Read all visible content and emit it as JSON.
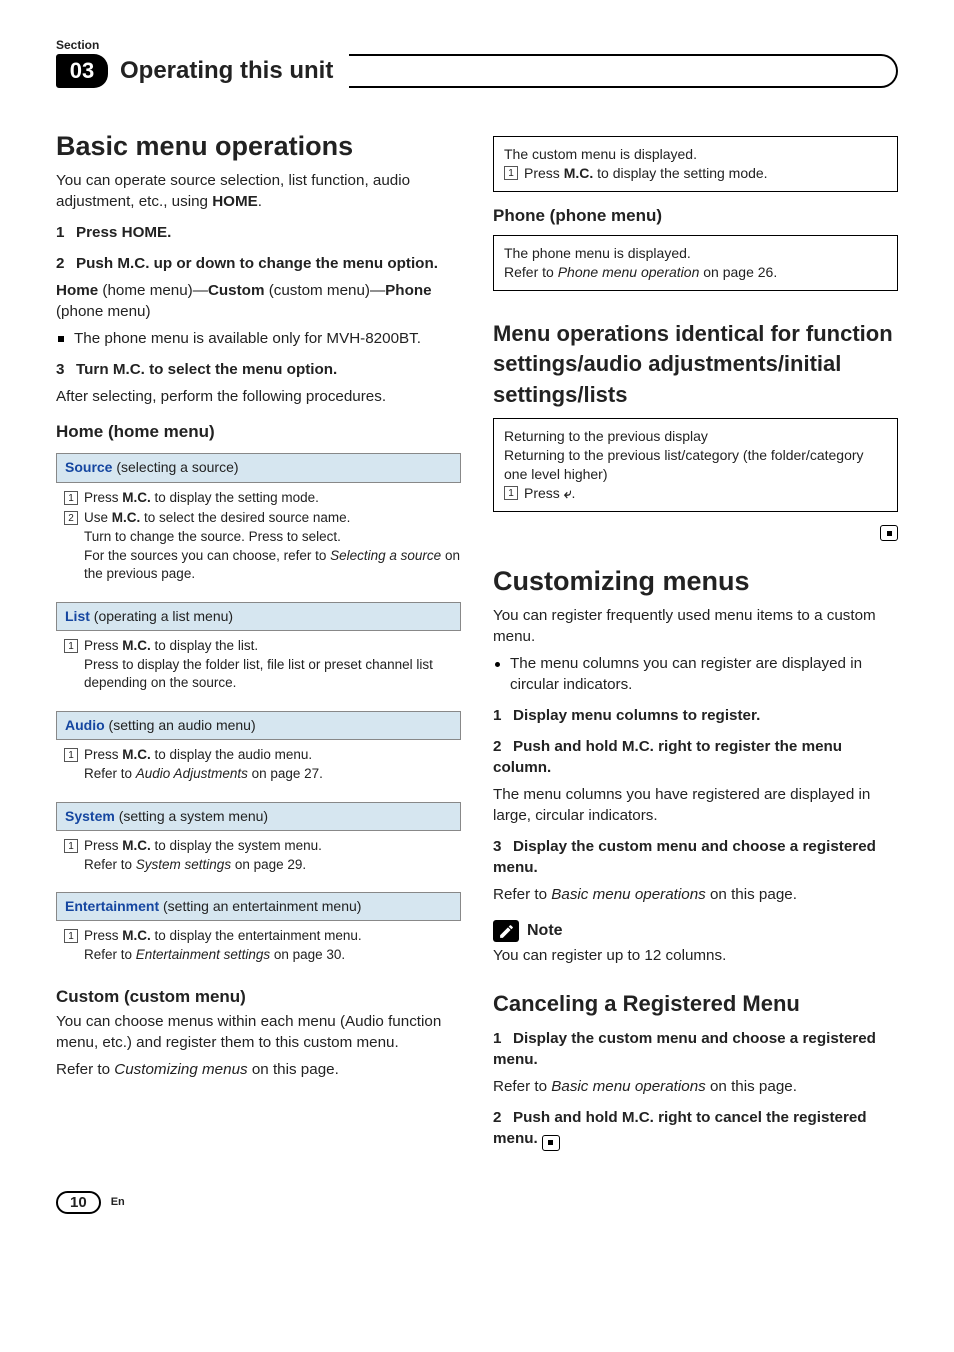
{
  "section_label": "Section",
  "chapter_num": "03",
  "chapter_title": "Operating this unit",
  "left": {
    "h1": "Basic menu operations",
    "intro_a": "You can operate source selection, list function, audio adjustment, etc., using ",
    "intro_b": "HOME",
    "intro_c": ".",
    "step1": "Press HOME.",
    "step2": "Push M.C. up or down to change the menu option.",
    "chain_a": "Home",
    "chain_b": " (home menu)—",
    "chain_c": "Custom",
    "chain_d": " (custom menu)—",
    "chain_e": "Phone",
    "chain_f": " (phone menu)",
    "note_line": "The phone menu is available only for MVH-8200BT.",
    "step3": "Turn M.C. to select the menu option.",
    "after3": "After selecting, perform the following procedures.",
    "home_sub": "Home (home menu)",
    "src_head_lbl": "Source",
    "src_head_txt": " (selecting a source)",
    "src1_a": "Press ",
    "src1_b": "M.C.",
    "src1_c": " to display the setting mode.",
    "src2_a": "Use ",
    "src2_b": "M.C.",
    "src2_c": " to select the desired source name.",
    "src2_d": "Turn to change the source. Press to select.",
    "src2_e": "For the sources you can choose, refer to ",
    "src2_f": "Selecting a source",
    "src2_g": " on the previous page.",
    "list_head_lbl": "List",
    "list_head_txt": " (operating a list menu)",
    "list1_a": "Press ",
    "list1_b": "M.C.",
    "list1_c": " to display the list.",
    "list1_d": "Press to display the folder list, file list or preset channel list depending on the source.",
    "aud_head_lbl": "Audio",
    "aud_head_txt": " (setting an audio menu)",
    "aud1_a": "Press ",
    "aud1_b": "M.C.",
    "aud1_c": " to display the audio menu.",
    "aud1_d": "Refer to ",
    "aud1_e": "Audio Adjustments",
    "aud1_f": " on page 27.",
    "sys_head_lbl": "System",
    "sys_head_txt": " (setting a system menu)",
    "sys1_a": "Press ",
    "sys1_b": "M.C.",
    "sys1_c": " to display the system menu.",
    "sys1_d": "Refer to ",
    "sys1_e": "System settings",
    "sys1_f": " on page 29.",
    "ent_head_lbl": "Entertainment",
    "ent_head_txt": " (setting an entertainment menu)",
    "ent1_a": "Press ",
    "ent1_b": "M.C.",
    "ent1_c": " to display the entertainment menu.",
    "ent1_d": "Refer to ",
    "ent1_e": "Entertainment settings",
    "ent1_f": " on page 30.",
    "custom_sub": "Custom (custom menu)",
    "custom_p1": "You can choose menus within each menu (Audio function menu, etc.) and register them to this custom menu.",
    "custom_p2_a": "Refer to ",
    "custom_p2_b": "Customizing menus",
    "custom_p2_c": " on this page."
  },
  "right": {
    "box1_line1": "The custom menu is displayed.",
    "box1_a": "Press ",
    "box1_b": "M.C.",
    "box1_c": " to display the setting mode.",
    "phone_sub": "Phone (phone menu)",
    "box2_line1": "The phone menu is displayed.",
    "box2_a": "Refer to ",
    "box2_b": "Phone menu operation",
    "box2_c": " on page 26.",
    "h2_ops": "Menu operations identical for function settings/audio adjustments/initial settings/lists",
    "box3_line1": "Returning to the previous display",
    "box3_line2": "Returning to the previous list/category (the folder/category one level higher)",
    "box3_a": "Press ",
    "box3_b": ".",
    "h1_cust": "Customizing menus",
    "cust_intro": "You can register frequently used menu items to a custom menu.",
    "cust_bullet": "The menu columns you can register are displayed in circular indicators.",
    "cstep1": "Display menu columns to register.",
    "cstep2": "Push and hold M.C. right to register the menu column.",
    "cstep2_p": "The menu columns you have registered are displayed in large, circular indicators.",
    "cstep3": "Display the custom menu and choose a registered menu.",
    "cstep3_a": "Refer to ",
    "cstep3_b": "Basic menu operations",
    "cstep3_c": " on this page.",
    "note_label": "Note",
    "note_txt": "You can register up to 12 columns.",
    "h2_cancel": "Canceling a Registered Menu",
    "can1": "Display the custom menu and choose a registered menu.",
    "can1_a": "Refer to ",
    "can1_b": "Basic menu operations",
    "can1_c": " on this page.",
    "can2": "Push and hold M.C. right to cancel the registered menu."
  },
  "page_num": "10",
  "page_lang": "En",
  "nums": {
    "n1": "1",
    "n2": "2",
    "n3": "3"
  }
}
